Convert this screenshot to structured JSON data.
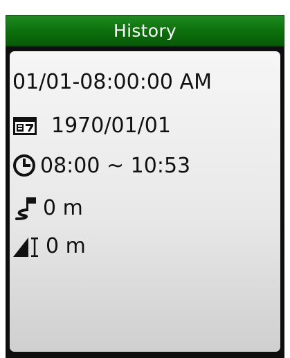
{
  "header": {
    "title": "History"
  },
  "record": {
    "datetime": "01/01-08:00:00 AM",
    "date": "1970/01/01",
    "time_range": "08:00 ~ 10:53",
    "distance": "0 m",
    "altitude": "0 m"
  },
  "icons": {
    "date": "calendar-icon",
    "time": "clock-icon",
    "distance": "route-flag-icon",
    "altitude": "altitude-icon"
  },
  "colors": {
    "title_bar": "#0b6e0b",
    "frame": "#0e0e0e",
    "panel": "#e8e8e8",
    "text": "#111111"
  }
}
